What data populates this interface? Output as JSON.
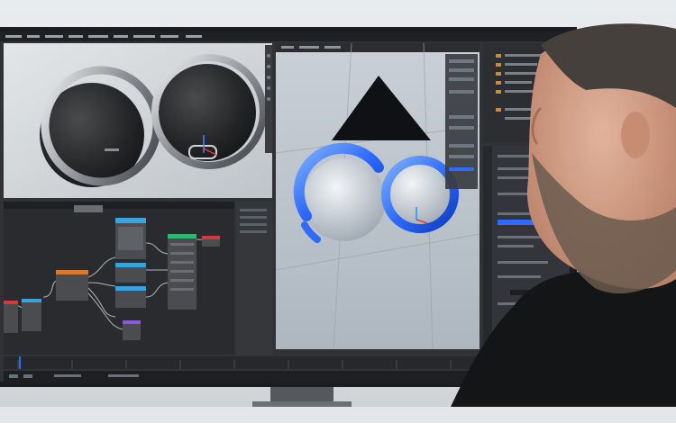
{
  "photo": {
    "description_colors": {
      "wall": "#d9dde0",
      "monitor_bezel": "#1b1d20",
      "blender_bg": "#303236",
      "node_editor_bg": "#2a2b2e",
      "viewport_grey": "#b9c2cb",
      "accent_blue": "#2f6bff",
      "sweater": "#131517",
      "skin": "#d8a58b",
      "beard": "#6a5a4d"
    }
  },
  "icons": {
    "speaker_object": "speaker-icon",
    "ring_handle": "ring-icon",
    "person": "person-icon"
  }
}
